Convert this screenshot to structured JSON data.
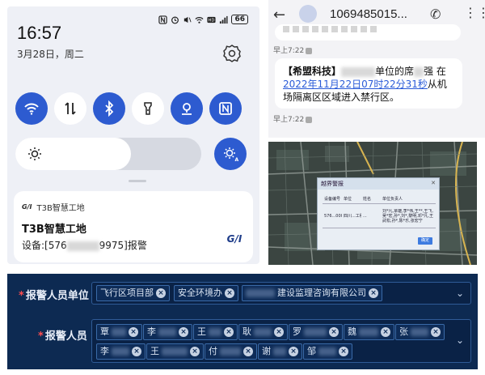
{
  "phone": {
    "battery": "66",
    "clock": "16:57",
    "date": "3月28日，周二",
    "notification": {
      "app_name": "T3B智慧工地",
      "app_badge": "G/I",
      "title": "T3B智慧工地",
      "body_prefix": "设备:[576",
      "body_suffix": "9975]报警",
      "logo": "G/I"
    },
    "brightness_level": 0.62,
    "tiles": [
      {
        "icon": "wifi-icon",
        "on": true
      },
      {
        "icon": "data-toggle-icon",
        "on": false
      },
      {
        "icon": "bluetooth-icon",
        "on": true
      },
      {
        "icon": "flashlight-icon",
        "on": false
      },
      {
        "icon": "location-icon",
        "on": true
      },
      {
        "icon": "nfc-icon",
        "on": true
      }
    ]
  },
  "sms": {
    "number": "1069485015...",
    "time1": "早上7:22",
    "time2": "早上7:22",
    "message": {
      "brand": "【希盟科技】",
      "part1": "单位的席",
      "name_visible": "强",
      "part2": " 在",
      "link": "2022年11月22日07时22分31秒",
      "part3": "从机场隔离区区域进入禁行区。"
    }
  },
  "map": {
    "dialog_title": "越界警报",
    "table_headers": [
      "设备编号",
      "单位",
      "姓名",
      "单位负责人"
    ],
    "table_row": [
      "576...0001523",
      "四川...工程有限公司",
      "...",
      "刘*凡,覃雄,李*伟,王**,王飞,吴*宏,孙*,刘*,黎明,邓*凡,王武松,孙*,陈*乐,张宏宁"
    ],
    "ok_label": "确定"
  },
  "form": {
    "unit_label": "报警人员单位",
    "unit_tags": [
      "飞行区项目部",
      "安全环境办",
      "建设监理咨询有限公司"
    ],
    "person_label": "报警人员",
    "person_tags_row1": [
      "覃",
      "李",
      "王",
      "耿",
      "罗",
      "魏",
      "张"
    ],
    "person_tags_row2": [
      "李",
      "王",
      "付",
      "谢",
      "邹"
    ]
  }
}
